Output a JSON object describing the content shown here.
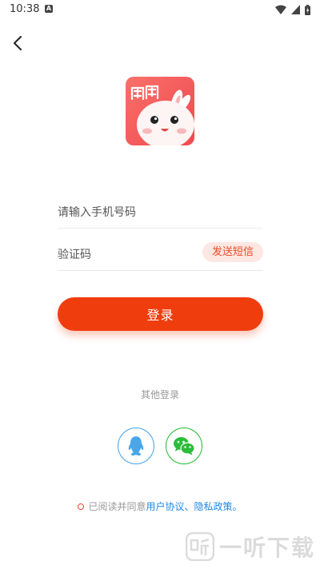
{
  "status_bar": {
    "time": "10:38",
    "notification_badge": "A"
  },
  "login": {
    "phone_placeholder": "请输入手机号码",
    "code_placeholder": "验证码",
    "send_sms_label": "发送短信",
    "login_button_label": "登录",
    "other_login_label": "其他登录"
  },
  "agreement": {
    "prefix": "已阅读并同意",
    "user_agreement": "用户协议",
    "separator": "、",
    "privacy_policy": "隐私政策",
    "suffix": "。"
  },
  "watermark": {
    "text": "一听下载"
  },
  "colors": {
    "accent": "#f03d0e",
    "sms_button_bg": "#fde7e2",
    "link": "#1e88e5",
    "qq": "#4aa6e8",
    "wechat": "#2bbd3a"
  },
  "icons": [
    "back-arrow-icon",
    "qq-icon",
    "wechat-icon",
    "wifi-icon",
    "signal-icon",
    "battery-icon",
    "app-logo"
  ]
}
